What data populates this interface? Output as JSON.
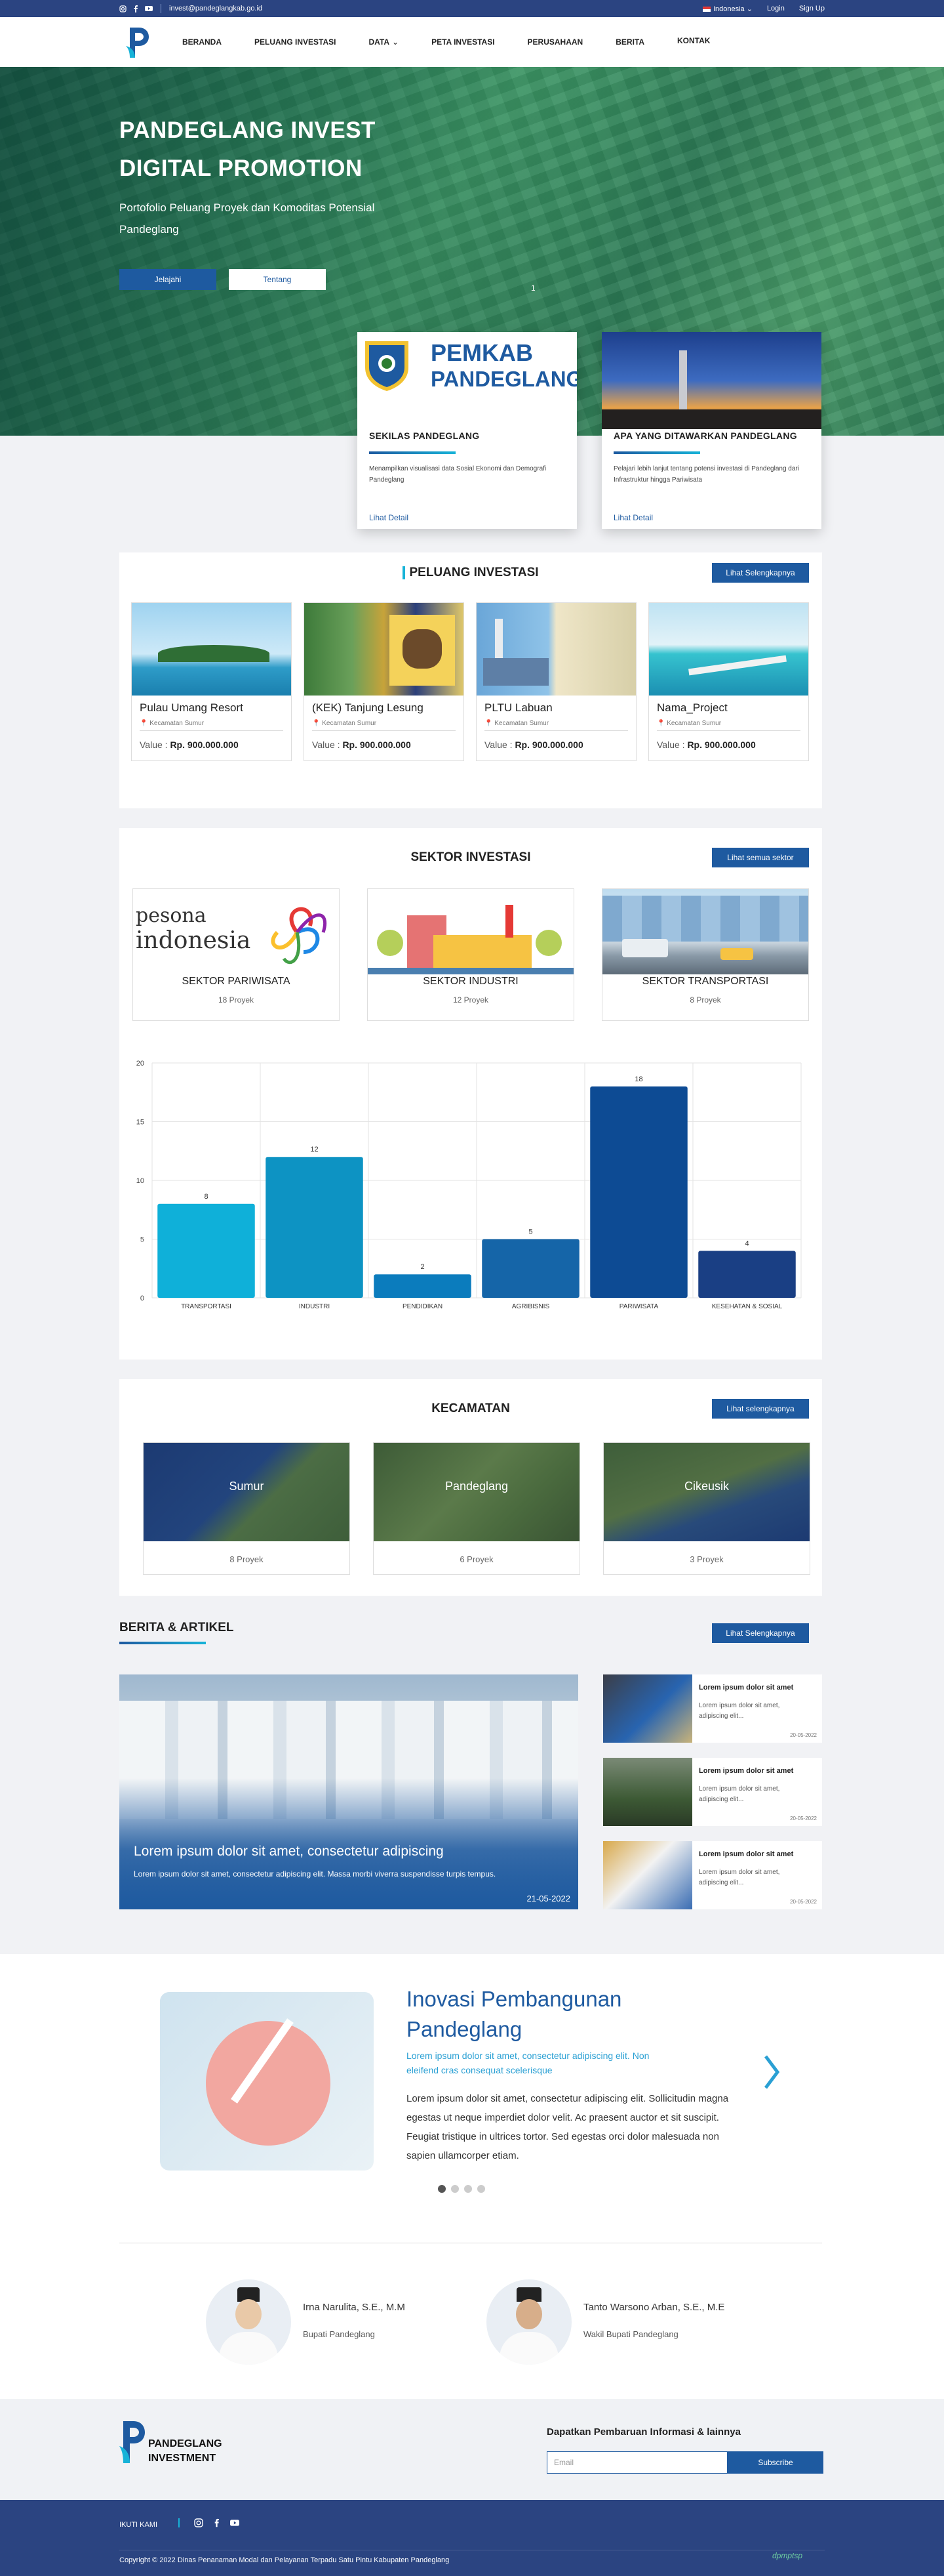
{
  "topbar": {
    "email": "invest@pandeglangkab.go.id",
    "language": "Indonesia",
    "login": "Login",
    "signup": "Sign Up",
    "social_icons": [
      "instagram-icon",
      "facebook-icon",
      "youtube-icon"
    ]
  },
  "nav": {
    "items": [
      "BERANDA",
      "PELUANG INVESTASI",
      "DATA",
      "PETA INVESTASI",
      "PERUSAHAAN",
      "BERITA",
      "KONTAK"
    ]
  },
  "hero": {
    "title": "PANDEGLANG INVEST DIGITAL PROMOTION",
    "subtitle": "Portofolio  Peluang Proyek dan Komoditas Potensial Pandeglang",
    "btn_primary": "Jelajahi",
    "btn_secondary": "Tentang",
    "page_indicator": "1"
  },
  "info_cards": [
    {
      "logo_line1": "PEMKAB",
      "logo_line2": "PANDEGLANG",
      "title": "SEKILAS PANDEGLANG",
      "text": "Menampilkan visualisasi data Sosial Ekonomi dan Demografi Pandeglang",
      "link": "Lihat Detail"
    },
    {
      "title": "APA YANG DITAWARKAN PANDEGLANG",
      "text": "Pelajari lebih lanjut tentang potensi investasi di Pandeglang dari Infrastruktur hingga Pariwisata",
      "link": "Lihat Detail"
    }
  ],
  "peluang": {
    "title": "PELUANG INVESTASI",
    "button": "Lihat Selengkapnya",
    "items": [
      {
        "name": "Pulau Umang Resort",
        "location": "Kecamatan Sumur",
        "value_label": "Value : ",
        "value": "Rp. 900.000.000"
      },
      {
        "name": "(KEK) Tanjung Lesung",
        "location": "Kecamatan Sumur",
        "value_label": "Value : ",
        "value": "Rp. 900.000.000"
      },
      {
        "name": "PLTU Labuan",
        "location": "Kecamatan Sumur",
        "value_label": "Value : ",
        "value": "Rp. 900.000.000"
      },
      {
        "name": "Nama_Project",
        "location": "Kecamatan Sumur",
        "value_label": "Value : ",
        "value": "Rp. 900.000.000"
      }
    ]
  },
  "sektor": {
    "title": "SEKTOR INVESTASI",
    "button": "Lihat semua sektor",
    "pesona_word1": "pesona",
    "pesona_word2": "indonesia",
    "items": [
      {
        "name": "SEKTOR PARIWISATA",
        "count": "18 Proyek"
      },
      {
        "name": "SEKTOR INDUSTRI",
        "count": "12 Proyek"
      },
      {
        "name": "SEKTOR TRANSPORTASI",
        "count": "8 Proyek"
      }
    ]
  },
  "chart_data": {
    "type": "bar",
    "categories": [
      "TRANSPORTASI",
      "INDUSTRI",
      "PENDIDIKAN",
      "AGRIBISNIS",
      "PARIWISATA",
      "KESEHATAN & SOSIAL"
    ],
    "values": [
      8,
      12,
      2,
      5,
      18,
      4
    ],
    "colors": [
      "#0fb0d9",
      "#0d93c3",
      "#0b7cbd",
      "#1565a8",
      "#0d4b94",
      "#1a3f84"
    ],
    "ylim": [
      0,
      20
    ],
    "yticks": [
      0,
      5,
      10,
      15,
      20
    ],
    "grid": true,
    "title": "",
    "xlabel": "",
    "ylabel": ""
  },
  "kecamatan": {
    "title": "KECAMATAN",
    "button": "Lihat selengkapnya",
    "items": [
      {
        "name": "Sumur",
        "count": "8 Proyek"
      },
      {
        "name": "Pandeglang",
        "count": "6 Proyek"
      },
      {
        "name": "Cikeusik",
        "count": "3 Proyek"
      }
    ]
  },
  "berita": {
    "title": "BERITA & ARTIKEL",
    "button": "Lihat Selengkapnya",
    "main": {
      "title": "Lorem ipsum dolor sit amet, consectetur adipiscing",
      "text": "Lorem ipsum dolor sit amet, consectetur adipiscing elit. Massa morbi viverra suspendisse turpis tempus.",
      "date": "21-05-2022"
    },
    "side": [
      {
        "title": "Lorem ipsum dolor sit amet",
        "text": "Lorem ipsum dolor sit amet, adipiscing elit...",
        "date": "20-05-2022"
      },
      {
        "title": "Lorem ipsum dolor sit amet",
        "text": "Lorem ipsum dolor sit amet, adipiscing elit...",
        "date": "20-05-2022"
      },
      {
        "title": "Lorem ipsum dolor sit amet",
        "text": "Lorem ipsum dolor sit amet, adipiscing elit...",
        "date": "20-05-2022"
      }
    ]
  },
  "inovasi": {
    "title": "Inovasi Pembangunan Pandeglang",
    "subtitle": "Lorem ipsum dolor sit amet, consectetur adipiscing elit. Non eleifend cras consequat scelerisque",
    "text": "Lorem ipsum dolor sit amet, consectetur adipiscing elit. Sollicitudin magna egestas ut neque imperdiet dolor velit. Ac praesent auctor et sit suscipit. Feugiat tristique in ultrices tortor. Sed egestas orci dolor malesuada non sapien ullamcorper etiam."
  },
  "leaders": [
    {
      "name": "Irna Narulita, S.E., M.M",
      "role": "Bupati Pandeglang"
    },
    {
      "name": "Tanto Warsono Arban, S.E., M.E",
      "role": "Wakil Bupati Pandeglang"
    }
  ],
  "footer": {
    "logo_line1": "PANDEGLANG",
    "logo_line2": "INVESTMENT",
    "subscribe_title": "Dapatkan Pembaruan Informasi & lainnya",
    "email_placeholder": "Email",
    "subscribe_button": "Subscribe",
    "follow": "IKUTI KAMI",
    "copyright": "Copyright © 2022 Dinas Penanaman Modal dan Pelayanan Terpadu Satu Pintu Kabupaten Pandeglang",
    "dpm_logo": "dpmptsp"
  },
  "colors": {
    "primary": "#1e5aa0",
    "navy": "#2b4481",
    "accent": "#17b3d8"
  }
}
